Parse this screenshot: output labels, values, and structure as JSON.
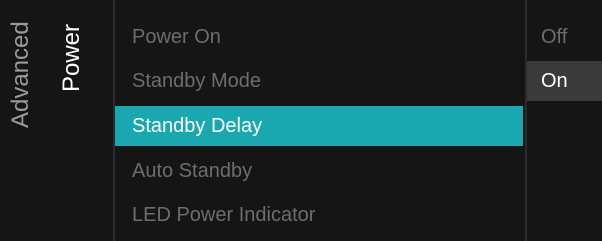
{
  "breadcrumb": {
    "parent": "Advanced",
    "current": "Power"
  },
  "menu": {
    "items": [
      {
        "label": "Power On",
        "state": "dim"
      },
      {
        "label": "Standby Mode",
        "state": "dim"
      },
      {
        "label": "Standby Delay",
        "state": "selected"
      },
      {
        "label": "Auto Standby",
        "state": "dim"
      },
      {
        "label": "LED Power Indicator",
        "state": "dim"
      }
    ]
  },
  "options": {
    "items": [
      {
        "label": "Off",
        "state": "dim"
      },
      {
        "label": "On",
        "state": "current"
      }
    ]
  },
  "colors": {
    "accent": "#1aa8b0",
    "panel": "#151515",
    "text_dim": "#6d6d6d",
    "text_active": "#ffffff"
  }
}
